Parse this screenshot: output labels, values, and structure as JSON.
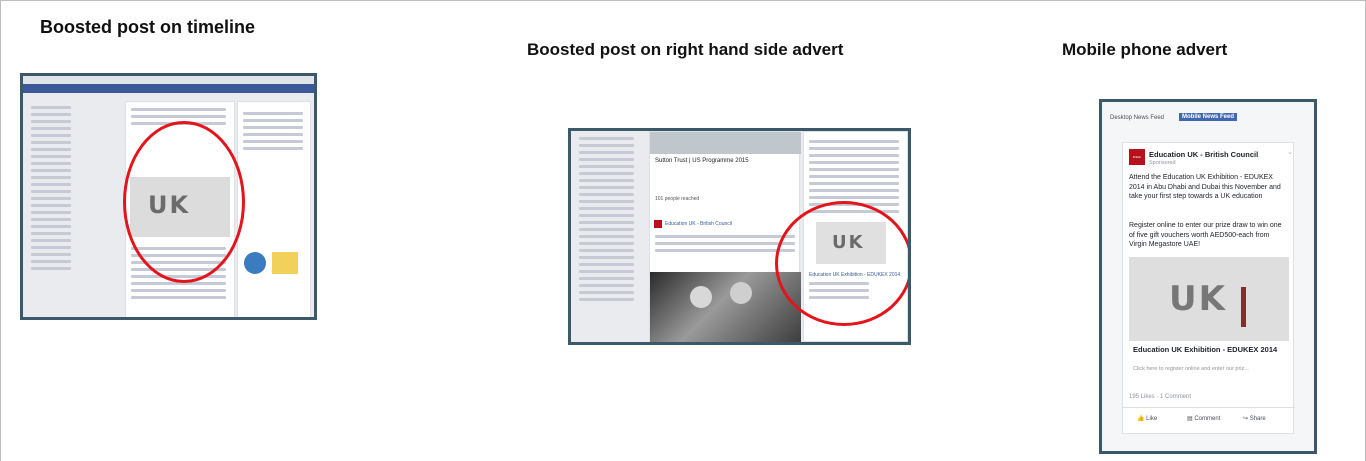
{
  "headings": {
    "timeline": "Boosted post on timeline",
    "right_side": "Boosted post on right hand side advert",
    "mobile": "Mobile phone advert"
  },
  "colors": {
    "facebook_blue": "#3b5998",
    "highlight_red": "#e3141b",
    "frame_border": "#3a5a6a"
  },
  "right_shot": {
    "post_title": "Sutton Trust | US Programme 2015",
    "post_author": "Education UK - British Council",
    "ad_title": "Education UK Exhibition - EDUKEX 2014",
    "people_count": "101 people reached"
  },
  "mobile": {
    "tab_desktop": "Desktop News Feed",
    "tab_mobile": "Mobile News Feed",
    "brand_badge": "British Council",
    "page_name": "Education UK - British Council",
    "sponsored": "Sponsored",
    "body_1": "Attend the Education UK Exhibition - EDUKEX 2014 in Abu Dhabi and Dubai this November and take your first step towards a UK education",
    "body_2": "Register online to enter our prize draw to win one of five gift vouchers worth AED500-each from Virgin Megastore UAE!",
    "link_title": "Education UK Exhibition - EDUKEX 2014",
    "link_desc": "Click here to register online and enter our priz...",
    "stats": "195 Likes · 1 Comment",
    "like": "Like",
    "comment": "Comment",
    "share": "Share"
  }
}
